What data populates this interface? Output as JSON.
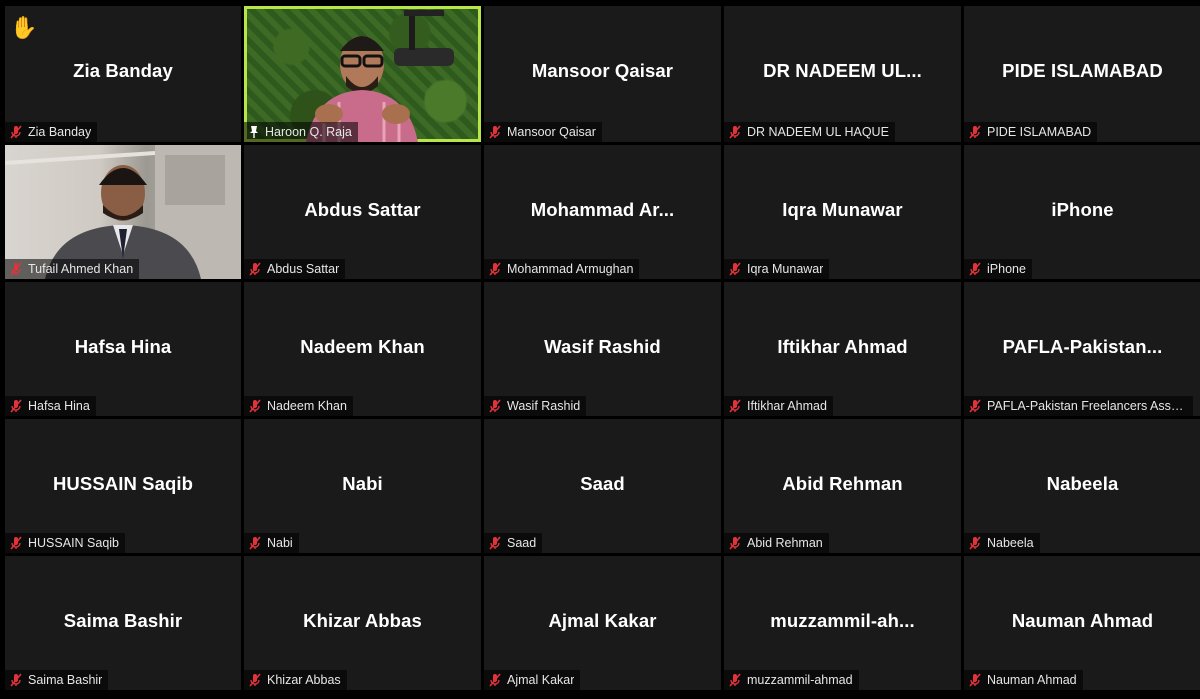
{
  "raised_hand": "✋",
  "tiles": [
    {
      "big": "Zia Banday",
      "label": "Zia Banday",
      "icon": "mic-muted-icon",
      "video": false
    },
    {
      "big": "",
      "label": "Haroon Q. Raja",
      "icon": "pin-icon",
      "video": true,
      "active": true
    },
    {
      "big": "Mansoor Qaisar",
      "label": "Mansoor Qaisar",
      "icon": "mic-muted-icon",
      "video": false
    },
    {
      "big": "DR NADEEM UL...",
      "label": "DR NADEEM UL HAQUE",
      "icon": "mic-muted-icon",
      "video": false
    },
    {
      "big": "PIDE ISLAMABAD",
      "label": "PIDE ISLAMABAD",
      "icon": "mic-muted-icon",
      "video": false
    },
    {
      "big": "",
      "label": "Tufail Ahmed Khan",
      "icon": "mic-muted-icon",
      "video": true
    },
    {
      "big": "Abdus Sattar",
      "label": "Abdus Sattar",
      "icon": "mic-muted-icon",
      "video": false
    },
    {
      "big": "Mohammad Ar...",
      "label": "Mohammad Armughan",
      "icon": "mic-muted-icon",
      "video": false
    },
    {
      "big": "Iqra Munawar",
      "label": "Iqra Munawar",
      "icon": "mic-muted-icon",
      "video": false
    },
    {
      "big": "iPhone",
      "label": "iPhone",
      "icon": "mic-muted-icon",
      "video": false
    },
    {
      "big": "Hafsa Hina",
      "label": "Hafsa Hina",
      "icon": "mic-muted-icon",
      "video": false
    },
    {
      "big": "Nadeem Khan",
      "label": "Nadeem Khan",
      "icon": "mic-muted-icon",
      "video": false
    },
    {
      "big": "Wasif Rashid",
      "label": "Wasif Rashid",
      "icon": "mic-muted-icon",
      "video": false
    },
    {
      "big": "Iftikhar Ahmad",
      "label": "Iftikhar Ahmad",
      "icon": "mic-muted-icon",
      "video": false
    },
    {
      "big": "PAFLA-Pakistan...",
      "label": "PAFLA-Pakistan Freelancers Associ...",
      "icon": "mic-muted-icon",
      "video": false
    },
    {
      "big": "HUSSAIN Saqib",
      "label": "HUSSAIN Saqib",
      "icon": "mic-muted-icon",
      "video": false
    },
    {
      "big": "Nabi",
      "label": "Nabi",
      "icon": "mic-muted-icon",
      "video": false
    },
    {
      "big": "Saad",
      "label": "Saad",
      "icon": "mic-muted-icon",
      "video": false
    },
    {
      "big": "Abid Rehman",
      "label": "Abid Rehman",
      "icon": "mic-muted-icon",
      "video": false
    },
    {
      "big": "Nabeela",
      "label": "Nabeela",
      "icon": "mic-muted-icon",
      "video": false
    },
    {
      "big": "Saima Bashir",
      "label": "Saima Bashir",
      "icon": "mic-muted-icon",
      "video": false
    },
    {
      "big": "Khizar Abbas",
      "label": "Khizar Abbas",
      "icon": "mic-muted-icon",
      "video": false
    },
    {
      "big": "Ajmal Kakar",
      "label": "Ajmal Kakar",
      "icon": "mic-muted-icon",
      "video": false
    },
    {
      "big": "muzzammil-ah...",
      "label": "muzzammil-ahmad",
      "icon": "mic-muted-icon",
      "video": false
    },
    {
      "big": "Nauman Ahmad",
      "label": "Nauman Ahmad",
      "icon": "mic-muted-icon",
      "video": false
    }
  ],
  "colors": {
    "tile_bg": "#1a1a1a",
    "active_border": "#b8e64a",
    "muted_red": "#e0333a"
  }
}
